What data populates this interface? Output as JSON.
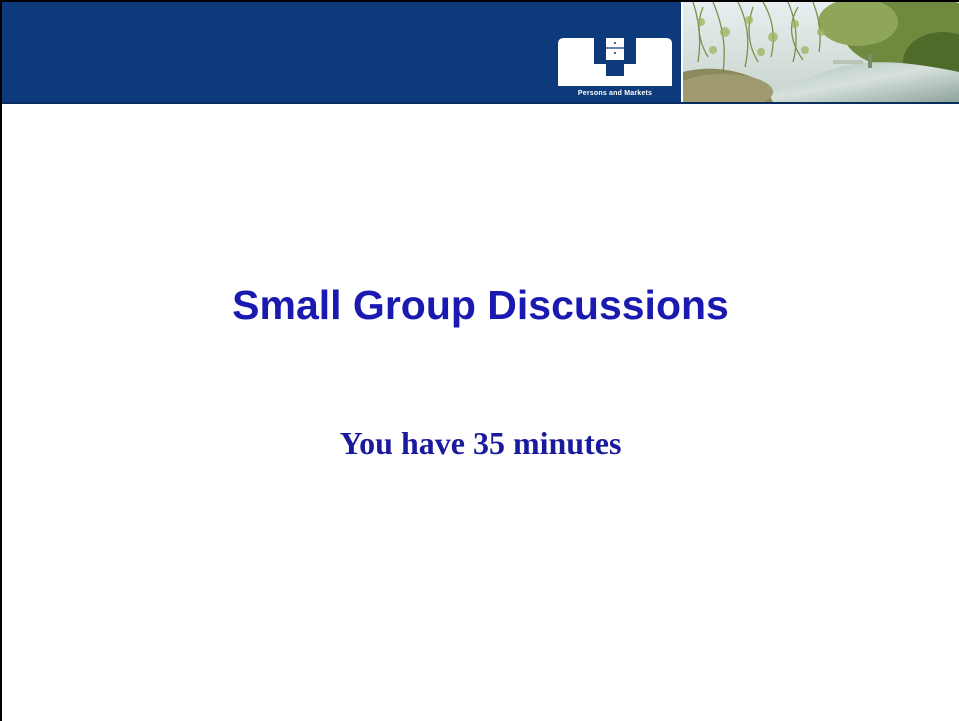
{
  "slide": {
    "title": "Small Group Discussions",
    "subtitle": "You have 35 minutes"
  },
  "header": {
    "logo_text": "Persons and Markets",
    "logo_icon": "organization-logo-icon",
    "photo": "river-landscape-photo"
  },
  "colors": {
    "header_background": "#0d3a7a",
    "title": "#1a1ab0",
    "subtitle": "#1a1a9c"
  }
}
